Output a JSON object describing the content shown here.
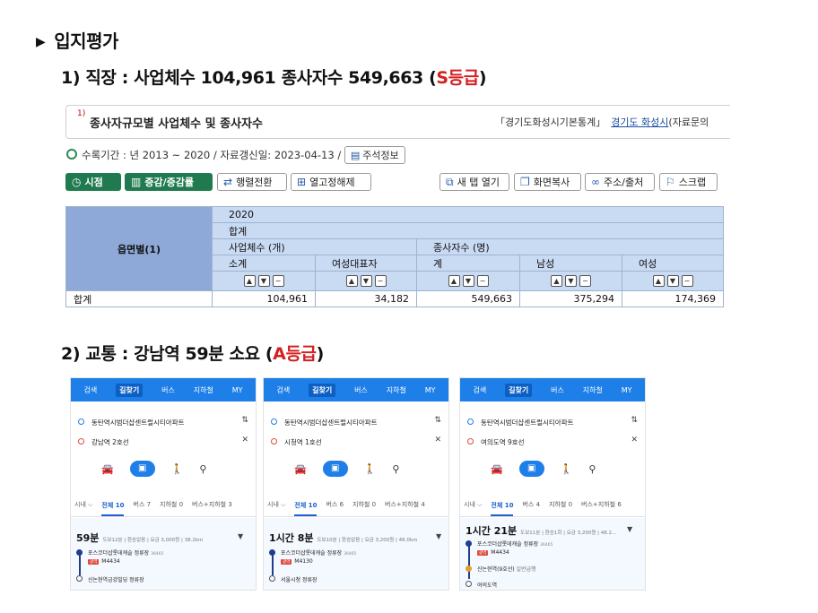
{
  "heading": {
    "marker": "▶",
    "text": "입지평가"
  },
  "section1": {
    "prefix": "1) 직장 : 사업체수 104,961 종사자수 549,663 (",
    "grade": "S등급",
    "suffix": ")"
  },
  "section2": {
    "prefix": "2) 교통 : 강남역 59분 소요 (",
    "grade": "A등급",
    "suffix": ")"
  },
  "stats": {
    "sup": "1)",
    "title": "종사자규모별 사업체수 및 종사자수",
    "source_label": "「경기도화성시기본통계」",
    "source_link": "경기도 화성시",
    "source_tail": "(자료문의",
    "meta": "수록기간 : 년 2013 ~ 2020 / 자료갱신일: 2023-04-13 /",
    "note_btn": "주석정보",
    "toolbar_left": [
      "시점",
      "증감/증감률",
      "행렬전환",
      "열고정해제"
    ],
    "toolbar_right": [
      "새 탭 열기",
      "화면복사",
      "주소/출처",
      "스크랩"
    ],
    "table": {
      "row_header": "읍면별(1)",
      "year": "2020",
      "total_header": "합계",
      "group1": "사업체수 (개)",
      "group2": "종사자수 (명)",
      "columns": [
        "소계",
        "여성대표자",
        "계",
        "남성",
        "여성"
      ],
      "row_label": "합계",
      "values": [
        "104,961",
        "34,182",
        "549,663",
        "375,294",
        "174,369"
      ]
    }
  },
  "phones": [
    {
      "tabs": [
        "검색",
        "길찾기",
        "버스",
        "지하철",
        "MY"
      ],
      "from": "동탄역시범더샵센트럴시티아파트",
      "to": "강남역 2호선",
      "filters": [
        "시내 ⌵",
        "전체 10",
        "버스 7",
        "지하철 0",
        "버스+지하철 3"
      ],
      "duration": "59분",
      "info": "도보12분 | 환승없음 | 요금 3,000원 | 38.2km",
      "stop1": "포스코더샵롯데캐슬 정류장",
      "stop1_code": "36465",
      "bus": "M4434",
      "stop2": "신논현역금강빌딩 정류장"
    },
    {
      "tabs": [
        "검색",
        "길찾기",
        "버스",
        "지하철",
        "MY"
      ],
      "from": "동탄역시범더샵센트럴시티아파트",
      "to": "시청역 1호선",
      "filters": [
        "시내 ⌵",
        "전체 10",
        "버스 6",
        "지하철 0",
        "버스+지하철 4"
      ],
      "duration": "1시간 8분",
      "info": "도보10분 | 환승없음 | 요금 3,200원 | 46.0km",
      "stop1": "포스코더샵롯데캐슬 정류장",
      "stop1_code": "36465",
      "bus": "M4130",
      "stop2": "서울시청 정류장"
    },
    {
      "tabs": [
        "검색",
        "길찾기",
        "버스",
        "지하철",
        "MY"
      ],
      "from": "동탄역시범더샵센트럴시티아파트",
      "to": "여의도역 9호선",
      "filters": [
        "시내 ⌵",
        "전체 10",
        "버스 4",
        "지하철 0",
        "버스+지하철 6"
      ],
      "duration": "1시간 21분",
      "info": "도보11분 | 환승1회 | 요금 3,200원 | 48.2...",
      "stop1": "포스코더샵롯데캐슬 정류장",
      "stop1_code": "36465",
      "bus": "M4434",
      "stop2": "신논현역(9호선)",
      "stop2_tag": "일반급행",
      "stop3": "여의도역"
    }
  ],
  "colors": {
    "grade": "#d42020",
    "header_blue": "#c9daf3",
    "rowhead_blue": "#8ea9d8",
    "app_blue": "#1f7fe8",
    "green_btn": "#1f7a4f"
  }
}
